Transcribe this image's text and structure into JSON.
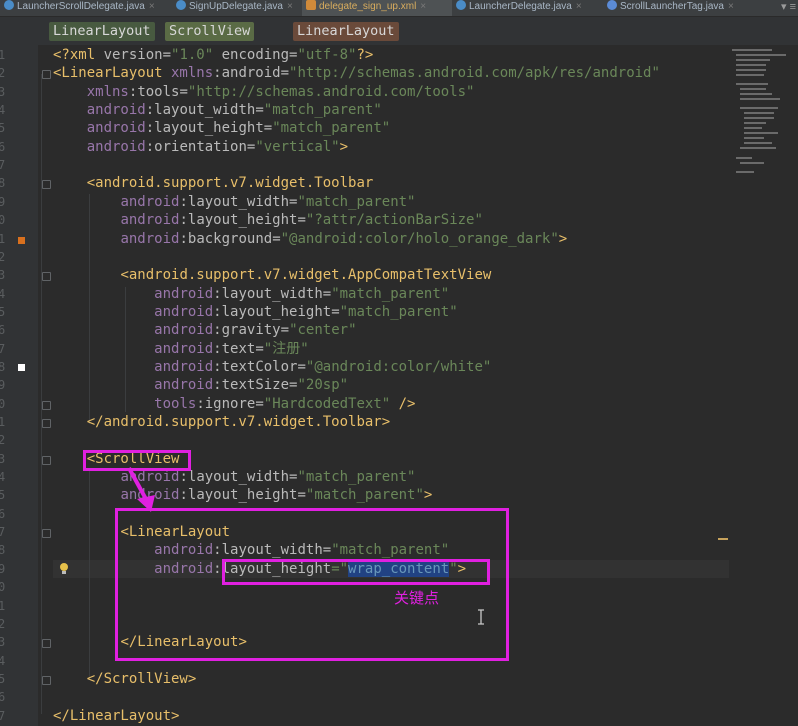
{
  "tabs": [
    {
      "label": "LauncherScrollDelegate.java",
      "active": false
    },
    {
      "label": "SignUpDelegate.java",
      "active": false
    },
    {
      "label": "delegate_sign_up.xml",
      "active": true
    },
    {
      "label": "LauncherDelegate.java",
      "active": false
    },
    {
      "label": "ScrollLauncherTag.java",
      "active": false
    }
  ],
  "tab_menu": "▾ ≡",
  "breadcrumbs": [
    "LinearLayout",
    "ScrollView",
    "LinearLayout"
  ],
  "line_numbers": [
    "1",
    "2",
    "3",
    "4",
    "5",
    "6",
    "7",
    "8",
    "9",
    "0",
    "1",
    "2",
    "3",
    "4",
    "5",
    "6",
    "7",
    "8",
    "9",
    "0",
    "1",
    "2",
    "3",
    "4",
    "5",
    "6",
    "7",
    "8",
    "9",
    "0",
    "1",
    "2",
    "3",
    "4",
    "5",
    "6",
    "7"
  ],
  "code": [
    {
      "tag_open": "<?xml ",
      "a1": "version=",
      "v1": "\"1.0\"",
      "a2": " encoding=",
      "v2": "\"utf-8\"",
      "tag_close": "?>"
    },
    {
      "tag": "<LinearLayout",
      "ns": " xmlns",
      "colon": ":",
      "attr": "android",
      "eq": "=",
      "val": "\"http://schemas.android.com/apk/res/android\""
    },
    {
      "ns": "xmlns",
      "colon": ":",
      "attr": "tools",
      "eq": "=",
      "val": "\"http://schemas.android.com/tools\""
    },
    {
      "ns": "android",
      "colon": ":",
      "attr": "layout_width",
      "eq": "=",
      "val": "\"match_parent\""
    },
    {
      "ns": "android",
      "colon": ":",
      "attr": "layout_height",
      "eq": "=",
      "val": "\"match_parent\""
    },
    {
      "ns": "android",
      "colon": ":",
      "attr": "orientation",
      "eq": "=",
      "val": "\"vertical\"",
      "end": ">"
    },
    {
      "blank": ""
    },
    {
      "tag": "<android.support.v7.widget.Toolbar"
    },
    {
      "ns": "android",
      "colon": ":",
      "attr": "layout_width",
      "eq": "=",
      "val": "\"match_parent\""
    },
    {
      "ns": "android",
      "colon": ":",
      "attr": "layout_height",
      "eq": "=",
      "val": "\"?attr/actionBarSize\""
    },
    {
      "ns": "android",
      "colon": ":",
      "attr": "background",
      "eq": "=",
      "val": "\"@android:color/holo_orange_dark\"",
      "end": ">"
    },
    {
      "blank": ""
    },
    {
      "tag": "<android.support.v7.widget.AppCompatTextView"
    },
    {
      "ns": "android",
      "colon": ":",
      "attr": "layout_width",
      "eq": "=",
      "val": "\"match_parent\""
    },
    {
      "ns": "android",
      "colon": ":",
      "attr": "layout_height",
      "eq": "=",
      "val": "\"match_parent\""
    },
    {
      "ns": "android",
      "colon": ":",
      "attr": "gravity",
      "eq": "=",
      "val": "\"center\""
    },
    {
      "ns": "android",
      "colon": ":",
      "attr": "text",
      "eq": "=",
      "val": "\"注册\""
    },
    {
      "ns": "android",
      "colon": ":",
      "attr": "textColor",
      "eq": "=",
      "val": "\"@android:color/white\""
    },
    {
      "ns": "android",
      "colon": ":",
      "attr": "textSize",
      "eq": "=",
      "val": "\"20sp\""
    },
    {
      "ns": "tools",
      "colon": ":",
      "attr": "ignore",
      "eq": "=",
      "val": "\"HardcodedText\"",
      "end": " />"
    },
    {
      "tag": "</android.support.v7.widget.Toolbar>"
    },
    {
      "blank": ""
    },
    {
      "tag": "<ScrollView"
    },
    {
      "ns": "android",
      "colon": ":",
      "attr": "layout_width",
      "eq": "=",
      "val": "\"match_parent\""
    },
    {
      "ns": "android",
      "colon": ":",
      "attr": "layout_height",
      "eq": "=",
      "val": "\"match_parent\"",
      "end": ">"
    },
    {
      "blank": ""
    },
    {
      "tag": "<LinearLayout"
    },
    {
      "ns": "android",
      "colon": ":",
      "attr": "layout_width",
      "eq": "=",
      "val": "\"match_parent\""
    },
    {
      "ns": "android",
      "colon": ":",
      "attr": "layout_height",
      "eq": "=\"",
      "sel": "wrap_content",
      "val": "\"",
      "end": ">"
    },
    {
      "blank": ""
    },
    {
      "blank": ""
    },
    {
      "blank": ""
    },
    {
      "tag": "</LinearLayout>"
    },
    {
      "blank": ""
    },
    {
      "tag": "</ScrollView>"
    },
    {
      "blank": ""
    },
    {
      "tag": "</LinearLayout>"
    }
  ],
  "annotation": "关键点",
  "colors": {
    "highlight": "#e020e0",
    "tag": "#e8bf6a",
    "string": "#6a8759",
    "namespace": "#9876aa"
  }
}
